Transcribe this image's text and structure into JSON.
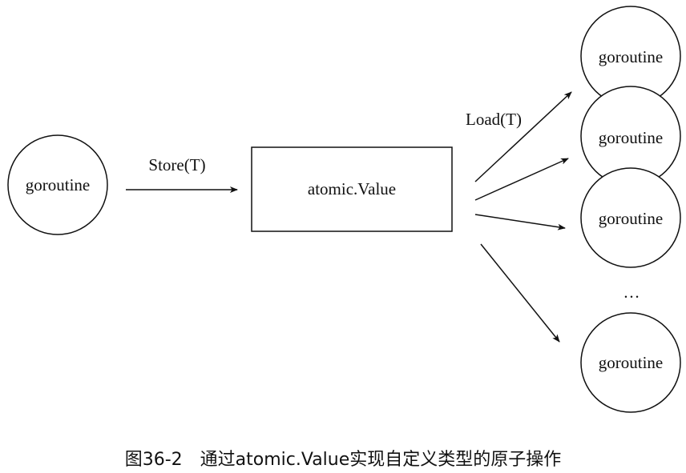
{
  "diagram": {
    "source_label": "goroutine",
    "store_label": "Store(T)",
    "value_label": "atomic.Value",
    "load_label": "Load(T)",
    "readers": [
      {
        "label": "goroutine"
      },
      {
        "label": "goroutine"
      },
      {
        "label": "goroutine"
      },
      {
        "label": "goroutine"
      }
    ],
    "ellipsis": "…"
  },
  "caption": "图36-2　通过atomic.Value实现自定义类型的原子操作"
}
